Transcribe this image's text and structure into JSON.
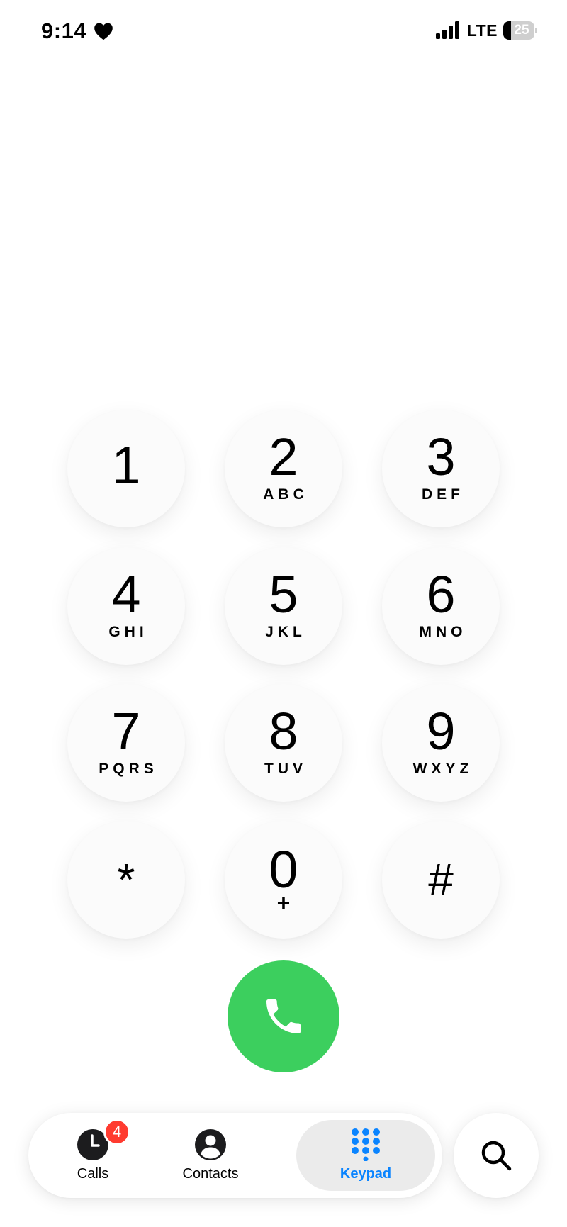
{
  "status_bar": {
    "time": "9:14",
    "status_icon": "heart-icon",
    "signal_icon": "cellular-signal-icon",
    "network": "LTE",
    "battery_percent": "25",
    "battery_level": 0.25
  },
  "keypad": {
    "keys": [
      {
        "digit": "1",
        "letters": ""
      },
      {
        "digit": "2",
        "letters": "ABC"
      },
      {
        "digit": "3",
        "letters": "DEF"
      },
      {
        "digit": "4",
        "letters": "GHI"
      },
      {
        "digit": "5",
        "letters": "JKL"
      },
      {
        "digit": "6",
        "letters": "MNO"
      },
      {
        "digit": "7",
        "letters": "PQRS"
      },
      {
        "digit": "8",
        "letters": "TUV"
      },
      {
        "digit": "9",
        "letters": "WXYZ"
      },
      {
        "digit": "*",
        "letters": ""
      },
      {
        "digit": "0",
        "letters": "+"
      },
      {
        "digit": "#",
        "letters": ""
      }
    ]
  },
  "call_button": {
    "icon": "phone-icon",
    "color": "#3ccf5e"
  },
  "tab_bar": {
    "tabs": [
      {
        "label": "Calls",
        "icon": "clock-icon",
        "badge": "4",
        "selected": false
      },
      {
        "label": "Contacts",
        "icon": "person-circle-icon",
        "selected": false
      },
      {
        "label": "Keypad",
        "icon": "keypad-grid-icon",
        "selected": true
      }
    ],
    "accent_color": "#0a84ff",
    "badge_color": "#ff3b30",
    "search_icon": "magnifying-glass-icon"
  }
}
